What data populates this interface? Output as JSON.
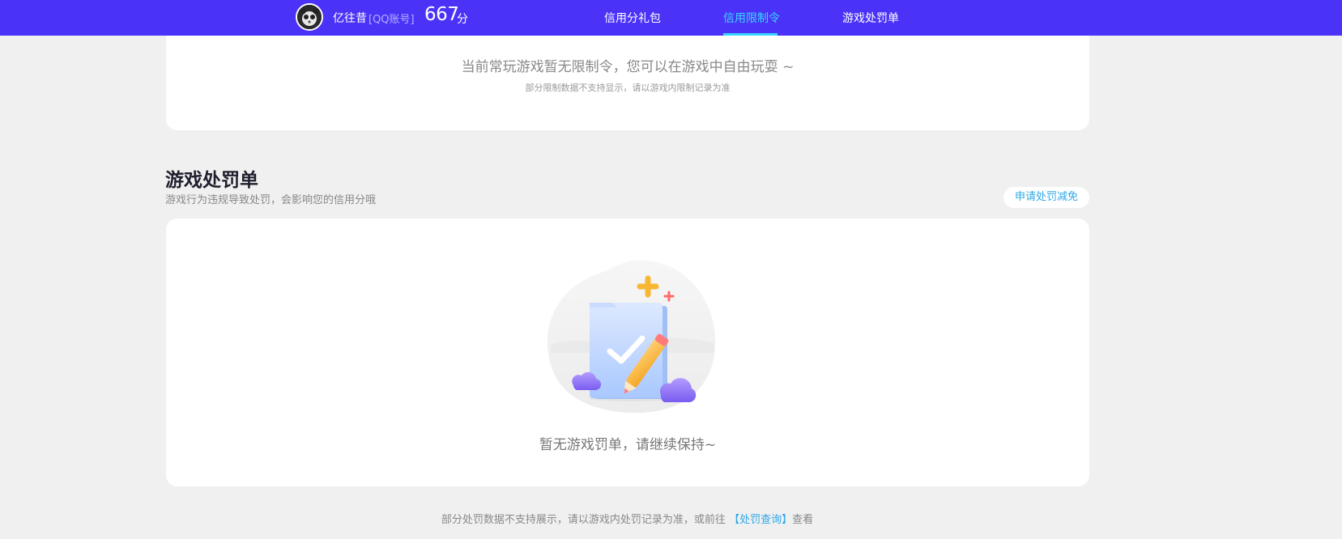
{
  "header": {
    "username": "亿往昔",
    "account_tag": "[QQ账号]",
    "score": "667",
    "score_unit": "分",
    "tabs": [
      {
        "label": "信用分礼包",
        "active": false
      },
      {
        "label": "信用限制令",
        "active": true
      },
      {
        "label": "游戏处罚单",
        "active": false
      }
    ],
    "accent_color": "#4a33f7",
    "active_color": "#39d6ff"
  },
  "restriction_card": {
    "message": "当前常玩游戏暂无限制令，您可以在游戏中自由玩耍 ~",
    "note": "部分限制数据不支持显示，请以游戏内限制记录为准"
  },
  "penalty_section": {
    "title": "游戏处罚单",
    "subtitle": "游戏行为违规导致处罚，会影响您的信用分哦",
    "appeal_button": "申请处罚减免",
    "empty_message": "暂无游戏罚单，请继续保持~",
    "illustration_icon": "checklist-pencil-icon"
  },
  "footer": {
    "prefix": "部分处罚数据不支持展示，请以游戏内处罚记录为准，或前往",
    "link": "【处罚查询】",
    "suffix": "查看"
  }
}
